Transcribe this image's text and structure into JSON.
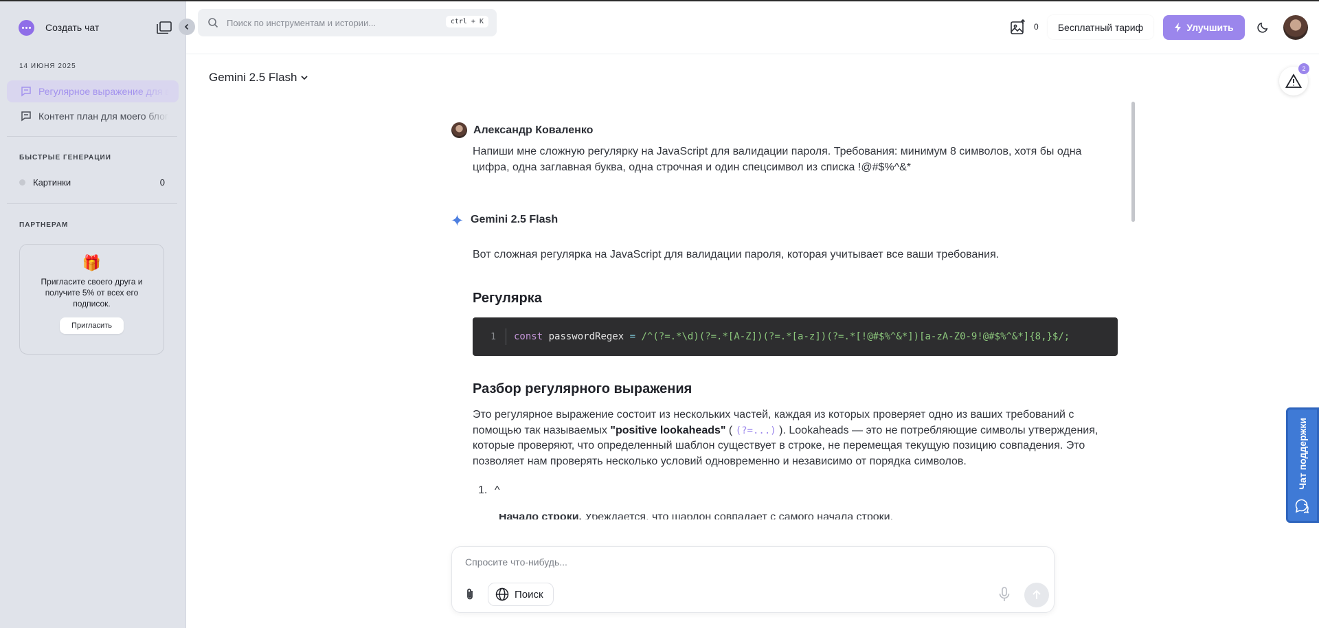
{
  "sidebar": {
    "new_chat_label": "Создать чат",
    "date_label": "14 ИЮНЯ 2025",
    "chats": [
      {
        "label": "Регулярное выражение для валидации пароля",
        "active": true
      },
      {
        "label": "Контент план для моего блога",
        "active": false
      }
    ],
    "quick_gen_title": "БЫСТРЫЕ ГЕНЕРАЦИИ",
    "quick_gen_items": [
      {
        "label": "Картинки",
        "count": "0"
      }
    ],
    "partners_title": "ПАРТНЕРАМ",
    "invite": {
      "text": "Пригласите своего друга и получите 5% от всех его подписок.",
      "button": "Пригласить"
    }
  },
  "header": {
    "search_placeholder": "Поиск по инструментам и истории...",
    "search_shortcut": "ctrl + K",
    "images_count": "0",
    "plan_label": "Бесплатный тариф",
    "upgrade_label": "Улучшить"
  },
  "model_selector": {
    "label": "Gemini 2.5 Flash"
  },
  "alerts": {
    "count": "2"
  },
  "conversation": {
    "user": {
      "name": "Александр Коваленко",
      "text": "Напиши мне сложную регулярку на JavaScript для валидации пароля. Требования: минимум 8 символов, хотя бы одна цифра, одна заглавная буква, одна строчная и один спецсимвол из списка !@#$%^&*"
    },
    "bot": {
      "name": "Gemini 2.5 Flash",
      "intro": "Вот сложная регулярка на JavaScript для валидации пароля, которая учитывает все ваши требования.",
      "heading_regex": "Регулярка",
      "code": {
        "line_number": "1",
        "keyword": "const",
        "variable": "passwordRegex",
        "operator": "=",
        "regex": "/^(?=.*\\d)(?=.*[A-Z])(?=.*[a-z])(?=.*[!@#$%^&*])[a-zA-Z0-9!@#$%^&*]{8,}$/;"
      },
      "heading_parse": "Разбор регулярного выражения",
      "parse_part1": "Это регулярное выражение состоит из нескольких частей, каждая из которых проверяет одно из ваших требований с помощью так называемых ",
      "parse_bold": "\"positive lookaheads\"",
      "parse_part2": " ( ",
      "parse_code": "(?=...)",
      "parse_part3": " ). Lookaheads — это не потребляющие символы утверждения, которые проверяют, что определенный шаблон существует в строке, не перемещая текущую позицию совпадения. Это позволяет нам проверять несколько условий одновременно и независимо от порядка символов.",
      "list_item_number": "1.",
      "list_item_text": "^",
      "clipped_bold": "Начало строки.",
      "clipped_text": " Убеждается, что шаблон совпадает с самого начала строки."
    }
  },
  "composer": {
    "placeholder": "Спросите что-нибудь...",
    "search_chip": "Поиск"
  },
  "support": {
    "label": "Чат поддержки"
  },
  "colors": {
    "accent": "#9b86ec",
    "sidebar_bg": "#e0e3ea",
    "support_blue": "#3f7ad6",
    "code_bg": "#2d2d2f"
  }
}
